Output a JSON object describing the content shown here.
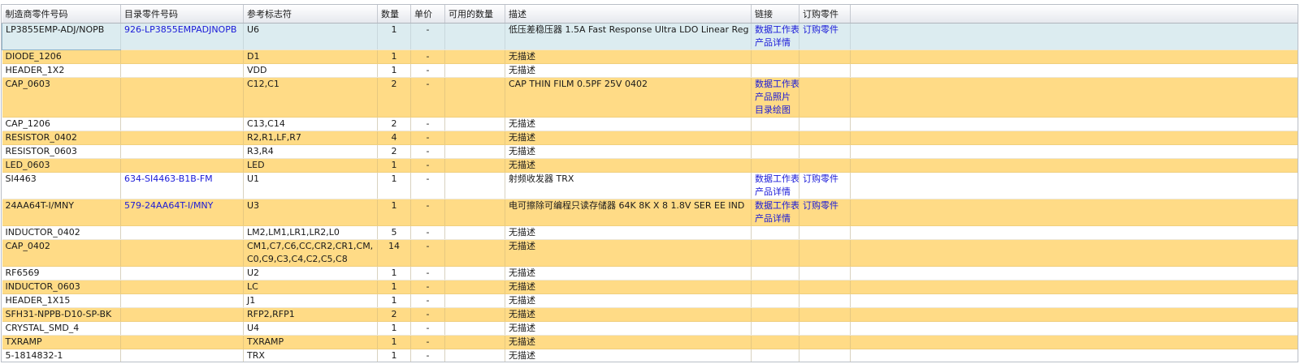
{
  "columns": [
    "制造商零件号码",
    "目录零件号码",
    "参考标志符",
    "数量",
    "单价",
    "可用的数量",
    "描述",
    "链接",
    "订购零件",
    ""
  ],
  "rows": [
    {
      "mpn": "LP3855EMP-ADJ/NOPB",
      "cat": "926-LP3855EMPADJNOPB",
      "ref": [
        "U6"
      ],
      "qty": "1",
      "price": "-",
      "avail": "",
      "desc": "低压差稳压器 1.5A Fast Response Ultra LDO Linear Reg",
      "links": [
        "数据工作表",
        "产品详情"
      ],
      "order": "订购零件",
      "style": "selected"
    },
    {
      "mpn": "DIODE_1206",
      "cat": "",
      "ref": [
        "D1"
      ],
      "qty": "1",
      "price": "-",
      "avail": "",
      "desc": "无描述",
      "links": [],
      "order": "",
      "style": "yellow"
    },
    {
      "mpn": "HEADER_1X2",
      "cat": "",
      "ref": [
        "VDD"
      ],
      "qty": "1",
      "price": "-",
      "avail": "",
      "desc": "无描述",
      "links": [],
      "order": "",
      "style": "white"
    },
    {
      "mpn": "CAP_0603",
      "cat": "",
      "ref": [
        "C12,C1"
      ],
      "qty": "2",
      "price": "-",
      "avail": "",
      "desc": "CAP THIN FILM 0.5PF 25V 0402",
      "links": [
        "数据工作表",
        "产品照片",
        "目录绘图"
      ],
      "order": "",
      "style": "yellow"
    },
    {
      "mpn": "CAP_1206",
      "cat": "",
      "ref": [
        "C13,C14"
      ],
      "qty": "2",
      "price": "-",
      "avail": "",
      "desc": "无描述",
      "links": [],
      "order": "",
      "style": "white"
    },
    {
      "mpn": "RESISTOR_0402",
      "cat": "",
      "ref": [
        "R2,R1,LF,R7"
      ],
      "qty": "4",
      "price": "-",
      "avail": "",
      "desc": "无描述",
      "links": [],
      "order": "",
      "style": "yellow"
    },
    {
      "mpn": "RESISTOR_0603",
      "cat": "",
      "ref": [
        "R3,R4"
      ],
      "qty": "2",
      "price": "-",
      "avail": "",
      "desc": "无描述",
      "links": [],
      "order": "",
      "style": "white"
    },
    {
      "mpn": "LED_0603",
      "cat": "",
      "ref": [
        "LED"
      ],
      "qty": "1",
      "price": "-",
      "avail": "",
      "desc": "无描述",
      "links": [],
      "order": "",
      "style": "yellow"
    },
    {
      "mpn": "SI4463",
      "cat": "634-SI4463-B1B-FM",
      "ref": [
        "U1"
      ],
      "qty": "1",
      "price": "-",
      "avail": "",
      "desc": "射频收发器 TRX",
      "links": [
        "数据工作表",
        "产品详情"
      ],
      "order": "订购零件",
      "style": "white"
    },
    {
      "mpn": "24AA64T-I/MNY",
      "cat": "579-24AA64T-I/MNY",
      "ref": [
        "U3"
      ],
      "qty": "1",
      "price": "-",
      "avail": "",
      "desc": "电可擦除可编程只读存储器 64K 8K X 8 1.8V SER EE IND",
      "links": [
        "数据工作表",
        "产品详情"
      ],
      "order": "订购零件",
      "style": "yellow"
    },
    {
      "mpn": "INDUCTOR_0402",
      "cat": "",
      "ref": [
        "LM2,LM1,LR1,LR2,L0"
      ],
      "qty": "5",
      "price": "-",
      "avail": "",
      "desc": "无描述",
      "links": [],
      "order": "",
      "style": "white"
    },
    {
      "mpn": "CAP_0402",
      "cat": "",
      "ref": [
        "CM1,C7,C6,CC,CR2,CR1,CM,",
        "C0,C9,C3,C4,C2,C5,C8"
      ],
      "qty": "14",
      "price": "-",
      "avail": "",
      "desc": "无描述",
      "links": [],
      "order": "",
      "style": "yellow"
    },
    {
      "mpn": "RF6569",
      "cat": "",
      "ref": [
        "U2"
      ],
      "qty": "1",
      "price": "-",
      "avail": "",
      "desc": "无描述",
      "links": [],
      "order": "",
      "style": "white"
    },
    {
      "mpn": "INDUCTOR_0603",
      "cat": "",
      "ref": [
        "LC"
      ],
      "qty": "1",
      "price": "-",
      "avail": "",
      "desc": "无描述",
      "links": [],
      "order": "",
      "style": "yellow"
    },
    {
      "mpn": "HEADER_1X15",
      "cat": "",
      "ref": [
        "J1"
      ],
      "qty": "1",
      "price": "-",
      "avail": "",
      "desc": "无描述",
      "links": [],
      "order": "",
      "style": "white"
    },
    {
      "mpn": "SFH31-NPPB-D10-SP-BK",
      "cat": "",
      "ref": [
        "RFP2,RFP1"
      ],
      "qty": "2",
      "price": "-",
      "avail": "",
      "desc": "无描述",
      "links": [],
      "order": "",
      "style": "yellow"
    },
    {
      "mpn": "CRYSTAL_SMD_4",
      "cat": "",
      "ref": [
        "U4"
      ],
      "qty": "1",
      "price": "-",
      "avail": "",
      "desc": "无描述",
      "links": [],
      "order": "",
      "style": "white"
    },
    {
      "mpn": "TXRAMP",
      "cat": "",
      "ref": [
        "TXRAMP"
      ],
      "qty": "1",
      "price": "-",
      "avail": "",
      "desc": "无描述",
      "links": [],
      "order": "",
      "style": "yellow"
    },
    {
      "mpn": "5-1814832-1",
      "cat": "",
      "ref": [
        "TRX"
      ],
      "qty": "1",
      "price": "-",
      "avail": "",
      "desc": "无描述",
      "links": [],
      "order": "",
      "style": "white"
    }
  ],
  "colors": {
    "row_highlight": "#ffdb86",
    "row_selected": "#dcecf0",
    "link": "#1a1ad8"
  }
}
